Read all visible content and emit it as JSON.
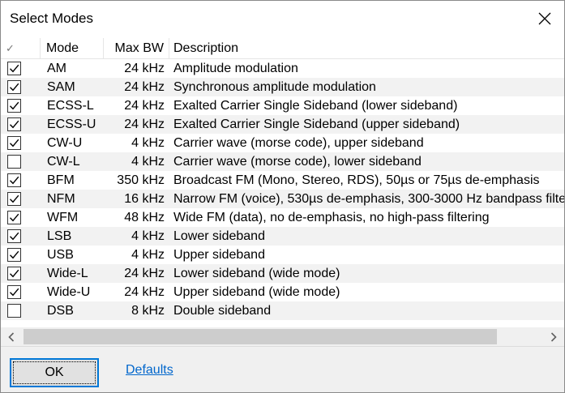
{
  "dialog": {
    "title": "Select Modes"
  },
  "list": {
    "columns": {
      "check": "✓",
      "mode": "Mode",
      "bw": "Max BW",
      "desc": "Description"
    },
    "rows": [
      {
        "checked": true,
        "mode": "AM",
        "bw": "24 kHz",
        "desc": "Amplitude modulation"
      },
      {
        "checked": true,
        "mode": "SAM",
        "bw": "24 kHz",
        "desc": "Synchronous amplitude modulation"
      },
      {
        "checked": true,
        "mode": "ECSS-L",
        "bw": "24 kHz",
        "desc": "Exalted Carrier Single Sideband (lower sideband)"
      },
      {
        "checked": true,
        "mode": "ECSS-U",
        "bw": "24 kHz",
        "desc": "Exalted Carrier Single Sideband (upper sideband)"
      },
      {
        "checked": true,
        "mode": "CW-U",
        "bw": "4 kHz",
        "desc": "Carrier wave (morse code), upper sideband"
      },
      {
        "checked": false,
        "mode": "CW-L",
        "bw": "4 kHz",
        "desc": "Carrier wave (morse code), lower sideband"
      },
      {
        "checked": true,
        "mode": "BFM",
        "bw": "350 kHz",
        "desc": "Broadcast FM (Mono, Stereo, RDS), 50µs or 75µs de-emphasis"
      },
      {
        "checked": true,
        "mode": "NFM",
        "bw": "16 kHz",
        "desc": "Narrow FM (voice), 530µs de-emphasis, 300-3000 Hz bandpass filte"
      },
      {
        "checked": true,
        "mode": "WFM",
        "bw": "48 kHz",
        "desc": "Wide FM (data), no de-emphasis, no high-pass filtering"
      },
      {
        "checked": true,
        "mode": "LSB",
        "bw": "4 kHz",
        "desc": "Lower sideband"
      },
      {
        "checked": true,
        "mode": "USB",
        "bw": "4 kHz",
        "desc": "Upper sideband"
      },
      {
        "checked": true,
        "mode": "Wide-L",
        "bw": "24 kHz",
        "desc": "Lower sideband (wide mode)"
      },
      {
        "checked": true,
        "mode": "Wide-U",
        "bw": "24 kHz",
        "desc": "Upper sideband (wide mode)"
      },
      {
        "checked": false,
        "mode": "DSB",
        "bw": "8 kHz",
        "desc": "Double sideband"
      }
    ]
  },
  "footer": {
    "ok_label": "OK",
    "defaults_label": "Defaults"
  },
  "colors": {
    "accent": "#0078d7",
    "link": "#0066cc",
    "row_alt": "#f2f2f2"
  },
  "icons": {
    "close": "close-icon",
    "checkmark": "checkmark-icon",
    "scroll_left": "chevron-left-icon",
    "scroll_right": "chevron-right-icon"
  }
}
